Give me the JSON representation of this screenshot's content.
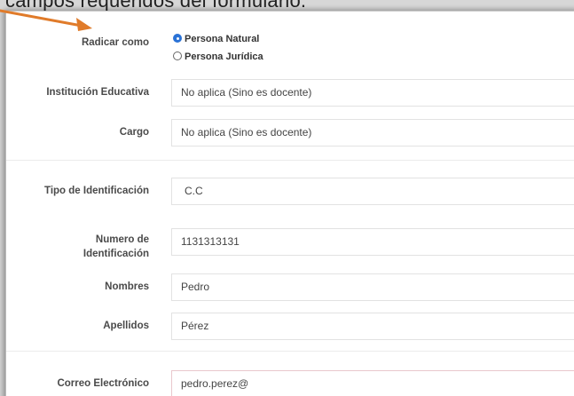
{
  "caption": "campos requeridos del formulario.",
  "form": {
    "radicar": {
      "label": "Radicar como",
      "options": [
        "Persona Natural",
        "Persona Jurídica"
      ],
      "selected": "Persona Natural"
    },
    "institucion": {
      "label": "Institución Educativa",
      "value": "No aplica (Sino es docente)"
    },
    "cargo": {
      "label": "Cargo",
      "value": "No aplica (Sino es docente)"
    },
    "tipo_id": {
      "label": "Tipo de Identificación",
      "value": "C.C"
    },
    "numero_id": {
      "label_line1": "Numero de",
      "label_line2": "Identificación",
      "value": "1131313131"
    },
    "nombres": {
      "label": "Nombres",
      "value": "Pedro"
    },
    "apellidos": {
      "label": "Apellidos",
      "value": "Pérez"
    },
    "correo": {
      "label": "Correo Electrónico",
      "value": "pedro.perez@"
    }
  },
  "colors": {
    "arrow": "#e07b2a",
    "radio_checked": "#2a72d6",
    "error_border": "#e9c8cc"
  }
}
